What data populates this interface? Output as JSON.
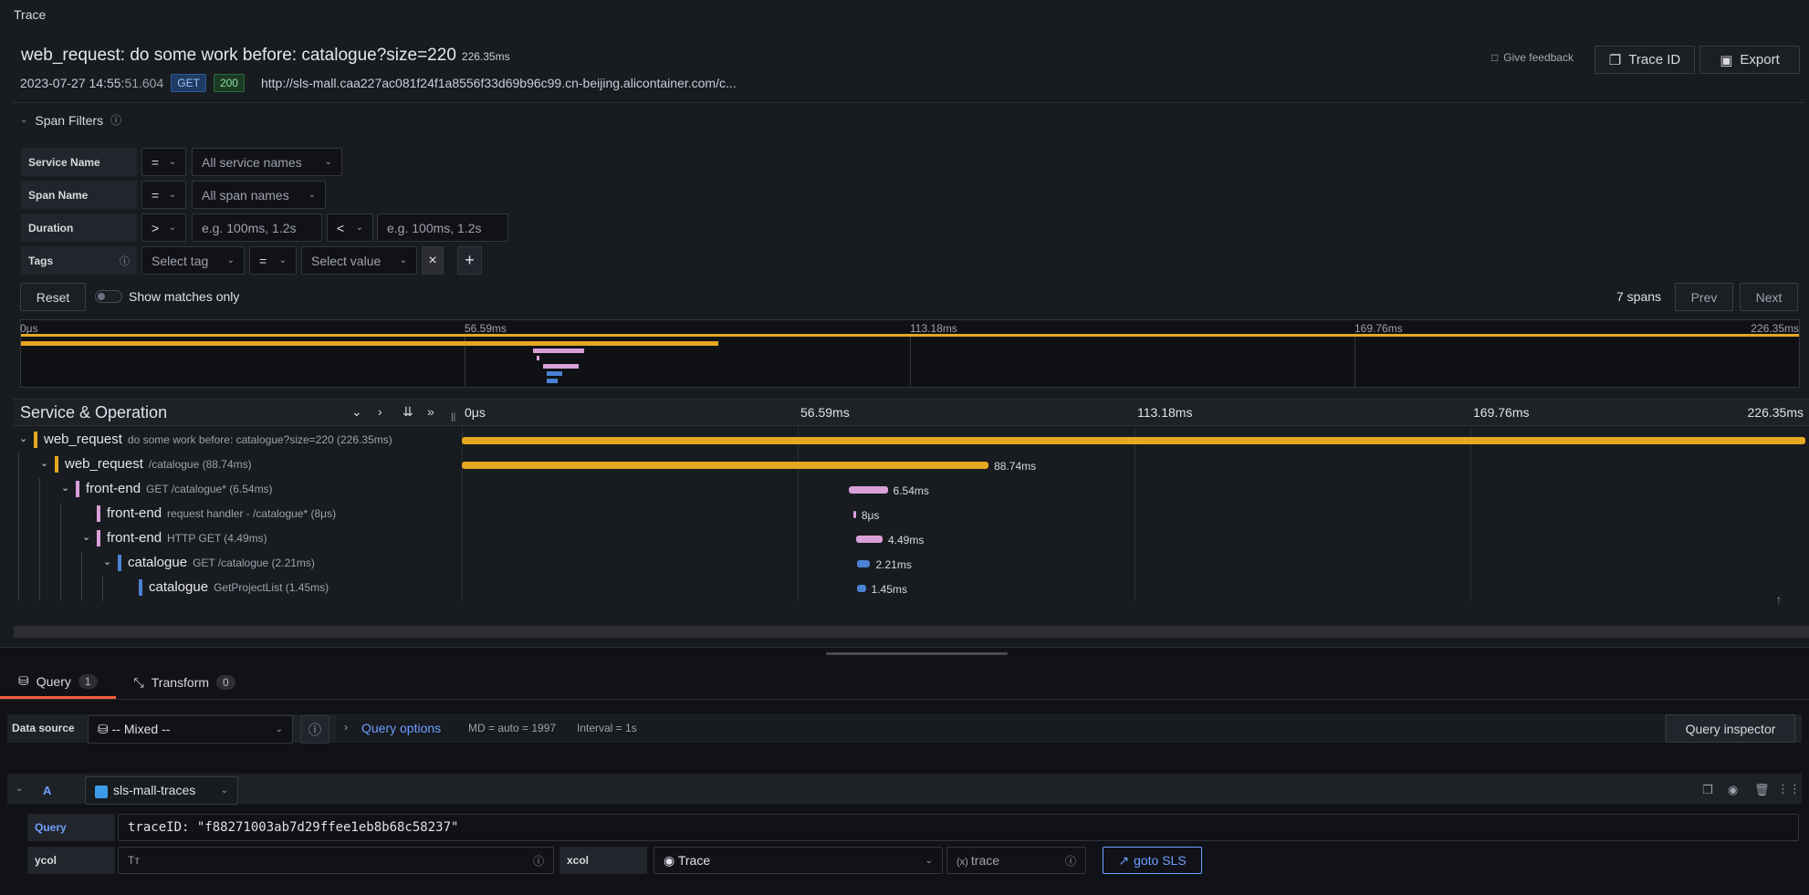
{
  "panel": {
    "title": "Trace"
  },
  "trace": {
    "name": "web_request: do some work before: catalogue?size=220",
    "duration": "226.35ms",
    "timestamp_main": "2023-07-27 14:55:",
    "timestamp_sub": "51.604",
    "method": "GET",
    "status": "200",
    "url": "http://sls-mall.caa227ac081f24f1a8556f33d69b96c99.cn-beijing.alicontainer.com/c..."
  },
  "header_actions": {
    "feedback": "Give feedback",
    "trace_id": "Trace ID",
    "export": "Export"
  },
  "span_filters": {
    "title": "Span Filters",
    "service_label": "Service Name",
    "service_op": "=",
    "service_placeholder": "All service names",
    "span_label": "Span Name",
    "span_op": "=",
    "span_placeholder": "All span names",
    "duration_label": "Duration",
    "duration_op_min": ">",
    "duration_min_placeholder": "e.g. 100ms, 1.2s",
    "duration_op_max": "<",
    "duration_max_placeholder": "e.g. 100ms, 1.2s",
    "tags_label": "Tags",
    "tag_placeholder": "Select tag",
    "tag_op": "=",
    "value_placeholder": "Select value",
    "remove": "×",
    "add": "+",
    "reset": "Reset",
    "show_matches": "Show matches only",
    "span_count": "7 spans",
    "prev": "Prev",
    "next": "Next"
  },
  "minimap": {
    "ticks": [
      "0μs",
      "56.59ms",
      "113.18ms",
      "169.76ms",
      "226.35ms"
    ]
  },
  "timeline": {
    "header": "Service & Operation",
    "ticks": [
      "0μs",
      "56.59ms",
      "113.18ms",
      "169.76ms",
      "226.35ms"
    ],
    "spans": [
      {
        "service": "web_request",
        "op": "do some work before: catalogue?size=220 (226.35ms)",
        "label": "",
        "color": "#e5a821",
        "depth": 0,
        "start": 0,
        "dur": 226.35,
        "toggle": "⌄"
      },
      {
        "service": "web_request",
        "op": "/catalogue (88.74ms)",
        "label": "88.74ms",
        "color": "#e5a821",
        "depth": 1,
        "start": 0,
        "dur": 88.74,
        "toggle": "⌄"
      },
      {
        "service": "front-end",
        "op": "GET /catalogue* (6.54ms)",
        "label": "6.54ms",
        "color": "#d9a0d8",
        "depth": 2,
        "start": 65.2,
        "dur": 6.54,
        "toggle": "⌄"
      },
      {
        "service": "front-end",
        "op": "request handler - /catalogue* (8μs)",
        "label": "8μs",
        "color": "#d9a0d8",
        "depth": 3,
        "start": 66.0,
        "dur": 0.4,
        "toggle": ""
      },
      {
        "service": "front-end",
        "op": "HTTP GET (4.49ms)",
        "label": "4.49ms",
        "color": "#d9a0d8",
        "depth": 3,
        "start": 66.4,
        "dur": 4.49,
        "toggle": "⌄"
      },
      {
        "service": "catalogue",
        "op": "GET /catalogue (2.21ms)",
        "label": "2.21ms",
        "color": "#4a82d4",
        "depth": 4,
        "start": 66.6,
        "dur": 2.21,
        "toggle": "⌄"
      },
      {
        "service": "catalogue",
        "op": "GetProjectList (1.45ms)",
        "label": "1.45ms",
        "color": "#4a82d4",
        "depth": 5,
        "start": 66.6,
        "dur": 1.45,
        "toggle": ""
      }
    ]
  },
  "query_tabs": [
    {
      "label": "Query",
      "count": "1"
    },
    {
      "label": "Transform",
      "count": "0"
    }
  ],
  "query_options": {
    "data_source_label": "Data source",
    "data_source_value": "-- Mixed --",
    "options_label": "Query options",
    "md": "MD = auto = 1997",
    "interval": "Interval = 1s",
    "inspector": "Query inspector"
  },
  "query_a": {
    "ref": "A",
    "datasource": "sls-mall-traces",
    "query_label": "Query",
    "query_value": "traceID: \"f88271003ab7d29ffee1eb8b68c58237\"",
    "ycol_label": "ycol",
    "ycol_placeholder": "Tт",
    "xcol_label": "xcol",
    "xcol_value": "Trace",
    "trace_placeholder": "trace",
    "goto": "goto SLS"
  },
  "colors": {
    "accent": "#f55f3e",
    "link": "#6e9fff",
    "web_request": "#e5a821",
    "front_end": "#d9a0d8",
    "catalogue": "#4a82d4"
  }
}
